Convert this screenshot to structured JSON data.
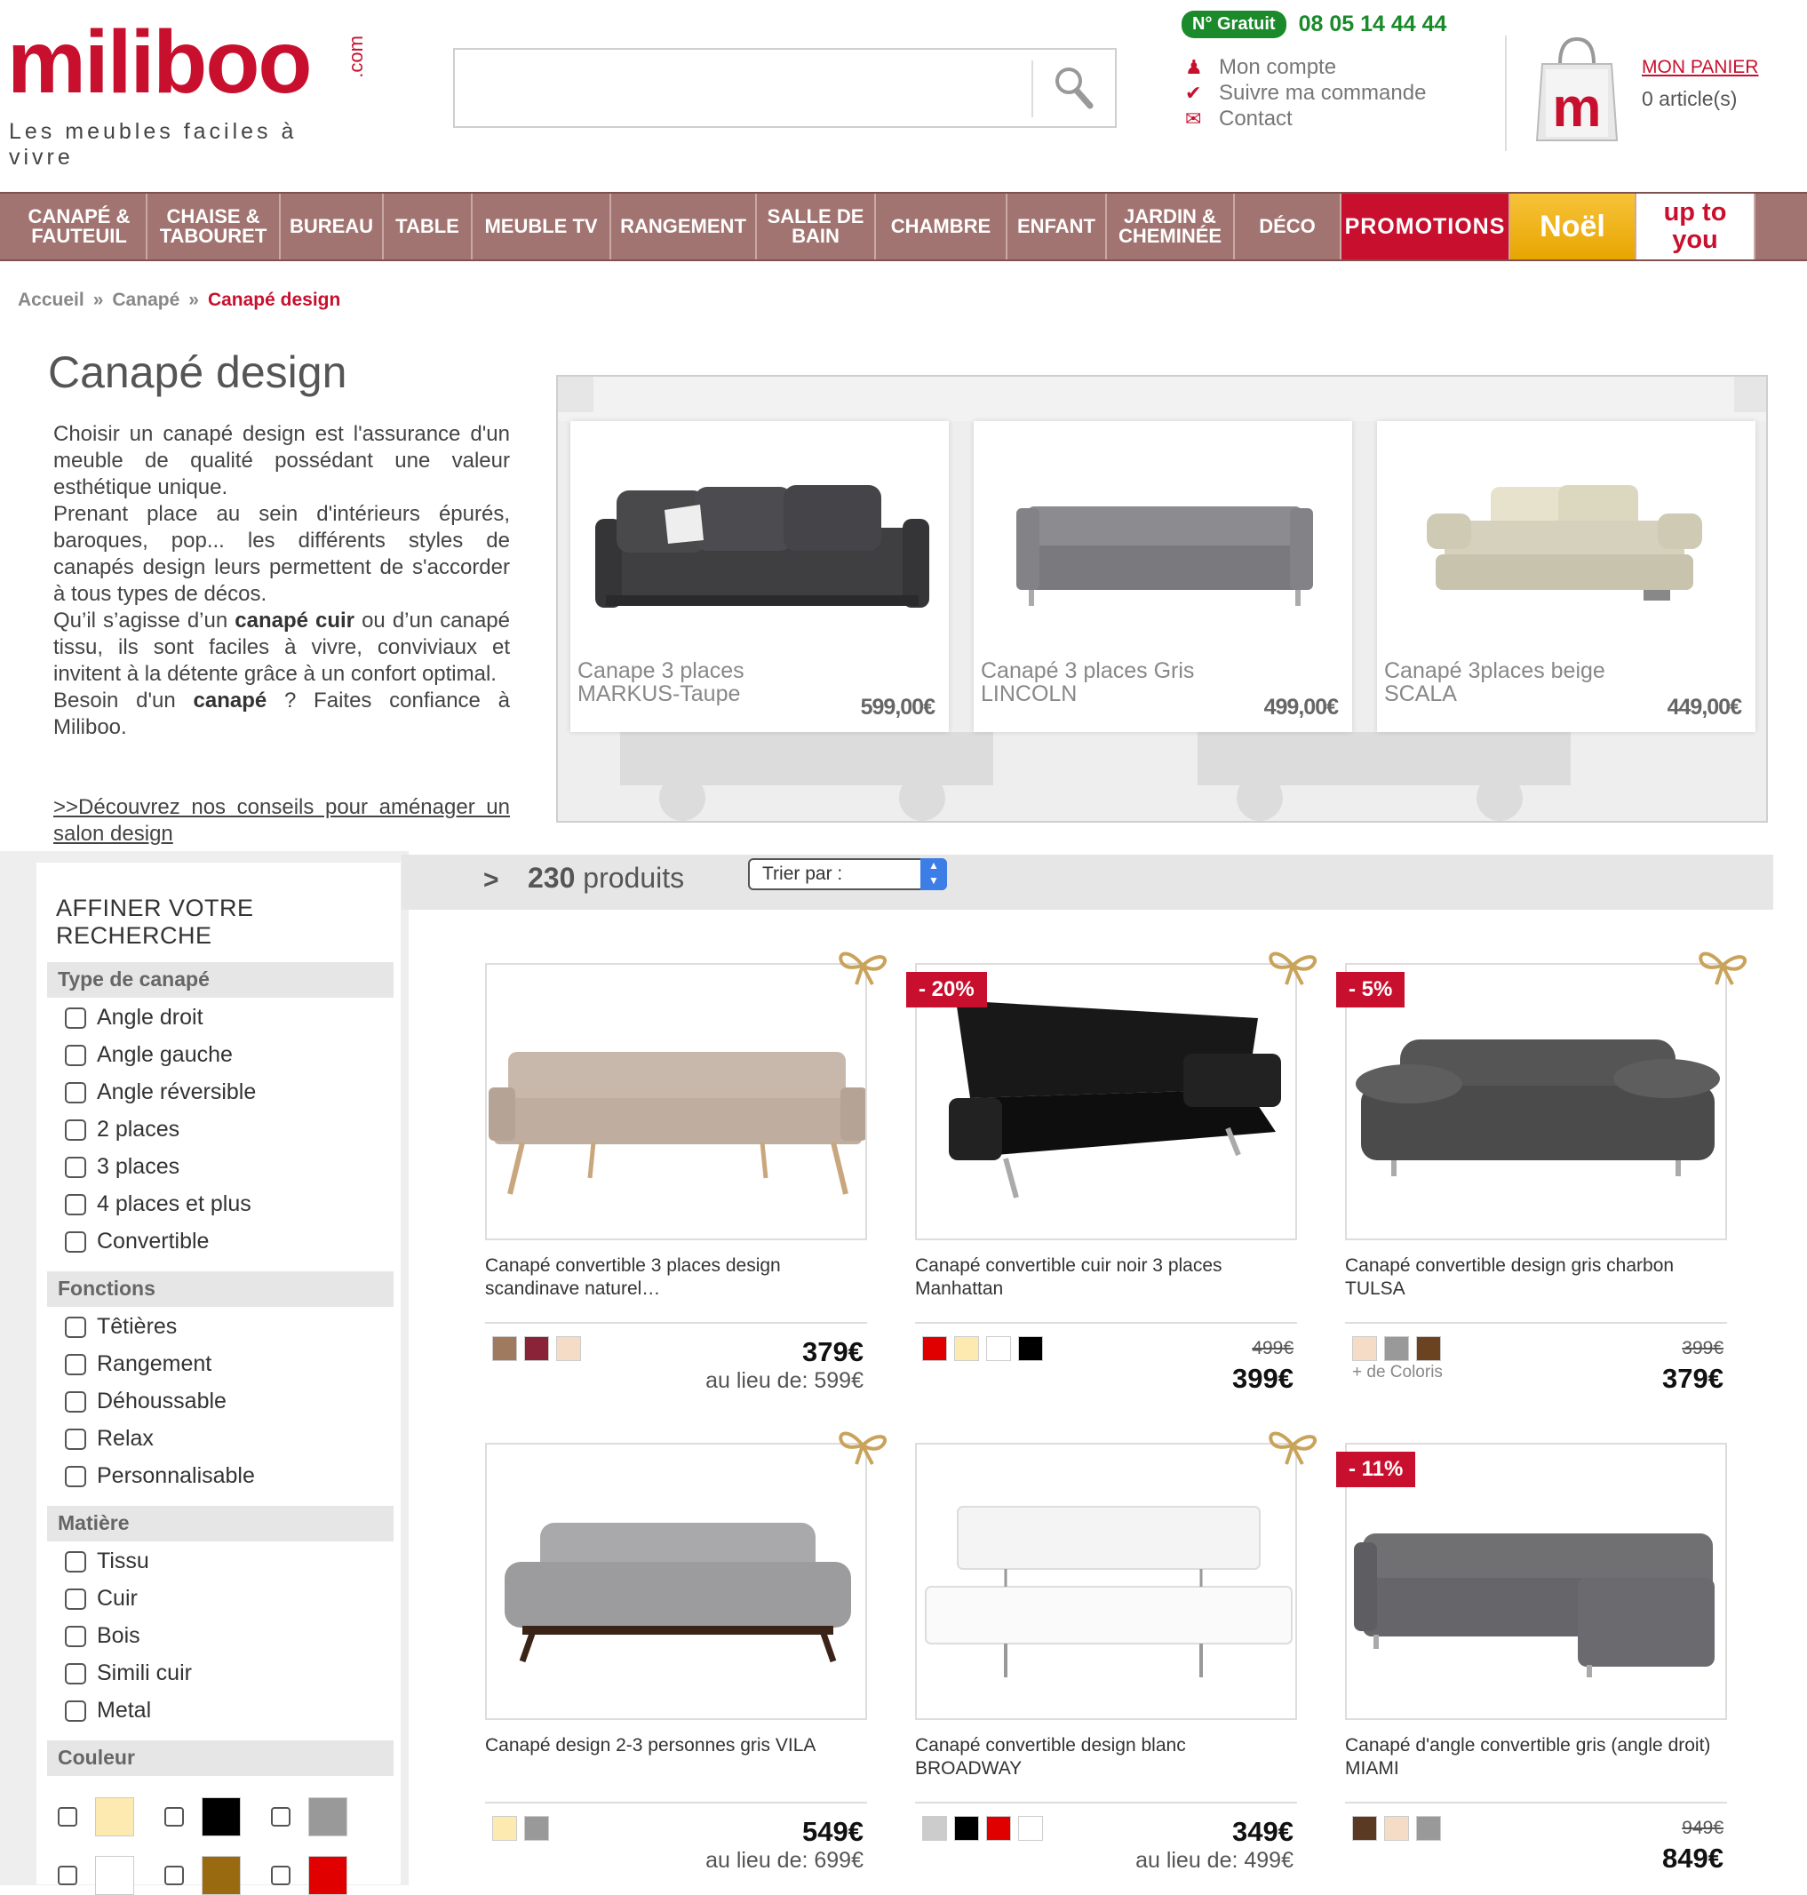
{
  "header": {
    "logo_word": "miliboo",
    "logo_com": ".com",
    "tagline": "Les meubles faciles à vivre",
    "phone_badge": "N° Gratuit",
    "phone": "08 05 14 44 44",
    "links": [
      "Mon compte",
      "Suivre ma commande",
      "Contact"
    ],
    "cart_title": "MON PANIER",
    "cart_count": "0 article(s)"
  },
  "nav": [
    {
      "label": "CANAPÉ & FAUTEUIL"
    },
    {
      "label": "CHAISE & TABOURET"
    },
    {
      "label": "BUREAU"
    },
    {
      "label": "TABLE"
    },
    {
      "label": "MEUBLE TV"
    },
    {
      "label": "RANGEMENT"
    },
    {
      "label": "SALLE DE BAIN"
    },
    {
      "label": "CHAMBRE"
    },
    {
      "label": "ENFANT"
    },
    {
      "label": "JARDIN & CHEMINÉE"
    },
    {
      "label": "DÉCO"
    },
    {
      "label": "PROMOTIONS"
    },
    {
      "label": "Noël"
    },
    {
      "label": "up to you"
    }
  ],
  "breadcrumb": [
    "Accueil",
    "Canapé",
    "Canapé design"
  ],
  "breadcrumb_sep": "»",
  "page_title": "Canapé design",
  "intro": {
    "p1": "Choisir un canapé design est l'assurance d'un meuble de qualité possédant une valeur esthétique unique.",
    "p2": "Prenant place au sein d'intérieurs épurés, baroques, pop... les différents styles de canapés design leurs permettent de s'accorder à tous types de décos.",
    "p3a": "Qu’il s’agisse d’un ",
    "p3b": "canapé cuir",
    "p3c": " ou d’un canapé tissu, ils sont faciles à vivre, conviviaux et invitent à la détente grâce à un confort optimal.",
    "p4a": "Besoin d'un ",
    "p4b": "canapé",
    "p4c": " ? Faites confiance à Miliboo.",
    "discover": ">>Découvrez nos conseils pour aménager un salon design"
  },
  "slider": [
    {
      "name": "Canape 3 places MARKUS-Taupe",
      "price": "599,00€"
    },
    {
      "name": "Canapé 3 places Gris LINCOLN",
      "price": "499,00€"
    },
    {
      "name": "Canapé 3places beige SCALA",
      "price": "449,00€"
    }
  ],
  "filters": {
    "title": "AFFINER VOTRE RECHERCHE",
    "groups": [
      {
        "label": "Type de canapé",
        "options": [
          "Angle droit",
          "Angle gauche",
          "Angle réversible",
          "2 places",
          "3 places",
          "4 places et plus",
          "Convertible"
        ]
      },
      {
        "label": "Fonctions",
        "options": [
          "Têtières",
          "Rangement",
          "Déhoussable",
          "Relax",
          "Personnalisable"
        ]
      },
      {
        "label": "Matière",
        "options": [
          "Tissu",
          "Cuir",
          "Bois",
          "Simili cuir",
          "Metal"
        ]
      },
      {
        "label": "Couleur",
        "options": []
      }
    ],
    "colors": [
      "#fdeab0",
      "#000000",
      "#999999",
      "#ffffff",
      "#9a6a10",
      "#e00000"
    ]
  },
  "results": {
    "arrow": ">",
    "count": "230",
    "count_label": " produits",
    "sort_label": "Trier par :"
  },
  "products": [
    {
      "name": "Canapé convertible 3 places design scandinave naturel…",
      "discount": "",
      "price": "379€",
      "old_price": "",
      "was": "au lieu de: 599€",
      "swatches": [
        "#a07a5e",
        "#8a2238",
        "#f4dcc7"
      ],
      "more": ""
    },
    {
      "name": "Canapé convertible cuir noir 3 places Manhattan",
      "discount": "- 20%",
      "price": "399€",
      "old_price": "499€",
      "was": "",
      "swatches": [
        "#e00000",
        "#fdeab0",
        "#ffffff",
        "#000000"
      ],
      "more": ""
    },
    {
      "name": "Canapé convertible design gris charbon TULSA",
      "discount": "- 5%",
      "price": "379€",
      "old_price": "399€",
      "was": "",
      "swatches": [
        "#f4dcc7",
        "#999999",
        "#6b4321"
      ],
      "more": "+ de Coloris"
    },
    {
      "name": "Canapé design 2-3 personnes gris VILA",
      "discount": "",
      "price": "549€",
      "old_price": "",
      "was": "au lieu de: 699€",
      "swatches": [
        "#fdeab0",
        "#999999"
      ],
      "more": ""
    },
    {
      "name": "Canapé convertible design blanc BROADWAY",
      "discount": "",
      "price": "349€",
      "old_price": "",
      "was": "au lieu de: 499€",
      "swatches": [
        "#cccccc",
        "#000000",
        "#e00000",
        "#ffffff"
      ],
      "more": ""
    },
    {
      "name": "Canapé d'angle convertible gris (angle droit) MIAMI",
      "discount": "- 11%",
      "price": "849€",
      "old_price": "949€",
      "was": "",
      "swatches": [
        "#5a3a22",
        "#f4dcc7",
        "#999999"
      ],
      "more": ""
    }
  ]
}
